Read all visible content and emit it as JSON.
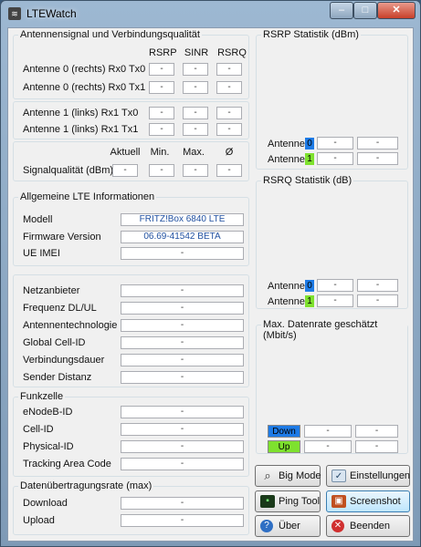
{
  "window": {
    "title": "LTEWatch",
    "controls": {
      "minimize": "–",
      "maximize": "□",
      "close": "✕"
    }
  },
  "antenna_group": {
    "title": "Antennensignal und Verbindungsqualität",
    "headers": [
      "RSRP",
      "SINR",
      "RSRQ"
    ],
    "rows": [
      {
        "label": "Antenne 0 (rechts) Rx0 Tx0",
        "values": [
          "-",
          "-",
          "-"
        ]
      },
      {
        "label": "Antenne 0 (rechts) Rx0 Tx1",
        "values": [
          "-",
          "-",
          "-"
        ]
      },
      {
        "label": "Antenne 1 (links) Rx1 Tx0",
        "values": [
          "-",
          "-",
          "-"
        ]
      },
      {
        "label": "Antenne 1 (links) Rx1 Tx1",
        "values": [
          "-",
          "-",
          "-"
        ]
      }
    ],
    "quality_headers": [
      "Aktuell",
      "Min.",
      "Max.",
      "Ø"
    ],
    "quality": {
      "label": "Signalqualität (dBm)",
      "values": [
        "-",
        "-",
        "-",
        "-"
      ]
    }
  },
  "lte_info": {
    "title": "Allgemeine LTE Informationen",
    "rows": [
      {
        "label": "Modell",
        "value": "FRITZ!Box 6840 LTE"
      },
      {
        "label": "Firmware Version",
        "value": "06.69-41542 BETA"
      },
      {
        "label": "UE IMEI",
        "value": "-"
      }
    ]
  },
  "network": {
    "rows": [
      {
        "label": "Netzanbieter",
        "value": "-"
      },
      {
        "label": "Frequenz DL/UL",
        "value": "-"
      },
      {
        "label": "Antennentechnologie",
        "value": "-"
      },
      {
        "label": "Global Cell-ID",
        "value": "-"
      },
      {
        "label": "Verbindungsdauer",
        "value": "-"
      },
      {
        "label": "Sender Distanz",
        "value": "-"
      }
    ]
  },
  "cell": {
    "title": "Funkzelle",
    "rows": [
      {
        "label": "eNodeB-ID",
        "value": "-"
      },
      {
        "label": "Cell-ID",
        "value": "-"
      },
      {
        "label": "Physical-ID",
        "value": "-"
      },
      {
        "label": "Tracking Area Code",
        "value": "-"
      }
    ]
  },
  "rate": {
    "title": "Datenübertragungsrate (max)",
    "rows": [
      {
        "label": "Download",
        "value": "-"
      },
      {
        "label": "Upload",
        "value": "-"
      }
    ]
  },
  "rsrp_stats": {
    "title": "RSRP Statistik (dBm)",
    "rows": [
      {
        "label": "Antenne",
        "num": "0",
        "color": "#1e7be6",
        "values": [
          "-",
          "-"
        ]
      },
      {
        "label": "Antenne",
        "num": "1",
        "color": "#7ee12e",
        "values": [
          "-",
          "-"
        ]
      }
    ]
  },
  "rsrq_stats": {
    "title": "RSRQ Statistik (dB)",
    "rows": [
      {
        "label": "Antenne",
        "num": "0",
        "color": "#1e7be6",
        "values": [
          "-",
          "-"
        ]
      },
      {
        "label": "Antenne",
        "num": "1",
        "color": "#7ee12e",
        "values": [
          "-",
          "-"
        ]
      }
    ]
  },
  "datarate": {
    "title": "Max. Datenrate geschätzt (Mbit/s)",
    "rows": [
      {
        "label": "Down",
        "color": "#1e7be6",
        "values": [
          "-",
          "-"
        ]
      },
      {
        "label": "Up",
        "color": "#7ee12e",
        "values": [
          "-",
          "-"
        ]
      }
    ]
  },
  "buttons": {
    "big_mode": "Big Mode",
    "settings": "Einstellungen",
    "ping_tool": "Ping Tool",
    "screenshot": "Screenshot",
    "about": "Über",
    "exit": "Beenden"
  }
}
